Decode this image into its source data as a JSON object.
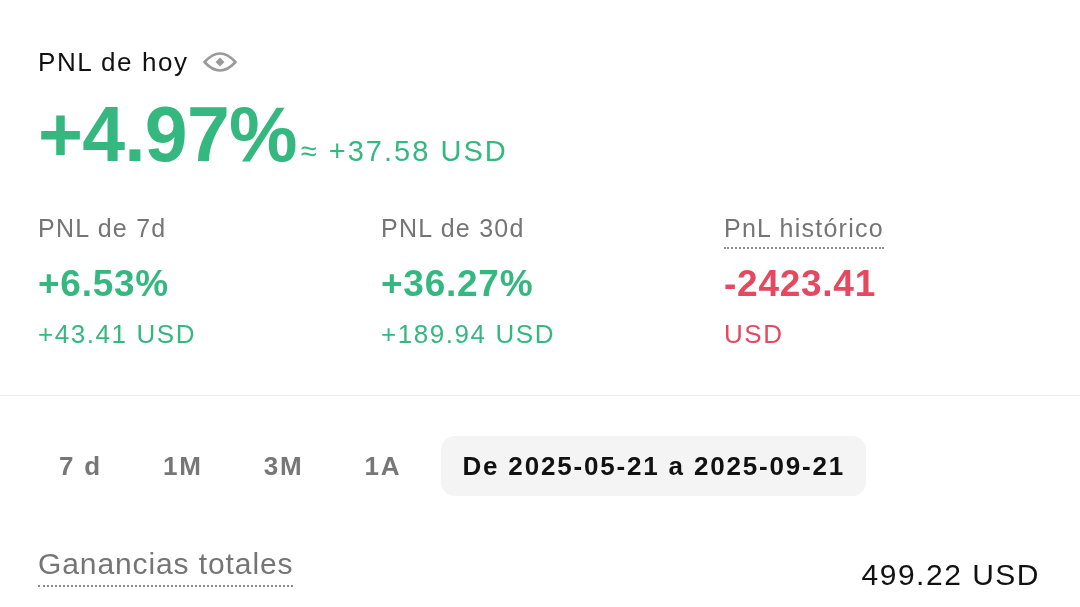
{
  "today": {
    "label": "PNL de hoy",
    "percent": "+4.97%",
    "amount": "≈ +37.58 USD"
  },
  "stats": [
    {
      "label": "PNL de 7d",
      "has_hint": false,
      "value": "+6.53%",
      "amount": "+43.41 USD",
      "color": "#35b880"
    },
    {
      "label": "PNL de 30d",
      "has_hint": false,
      "value": "+36.27%",
      "amount": "+189.94 USD",
      "color": "#35b880"
    },
    {
      "label": "PnL histórico",
      "has_hint": true,
      "value": "-2423.41",
      "amount": "USD",
      "color": "#e5485f"
    }
  ],
  "periods": [
    {
      "label": "7 d",
      "selected": false
    },
    {
      "label": "1M",
      "selected": false
    },
    {
      "label": "3M",
      "selected": false
    },
    {
      "label": "1A",
      "selected": false
    },
    {
      "label": "De 2025-05-21 a 2025-09-21",
      "selected": true
    }
  ],
  "total": {
    "label": "Ganancias totales",
    "has_hint": true,
    "value": "499.22 USD"
  }
}
